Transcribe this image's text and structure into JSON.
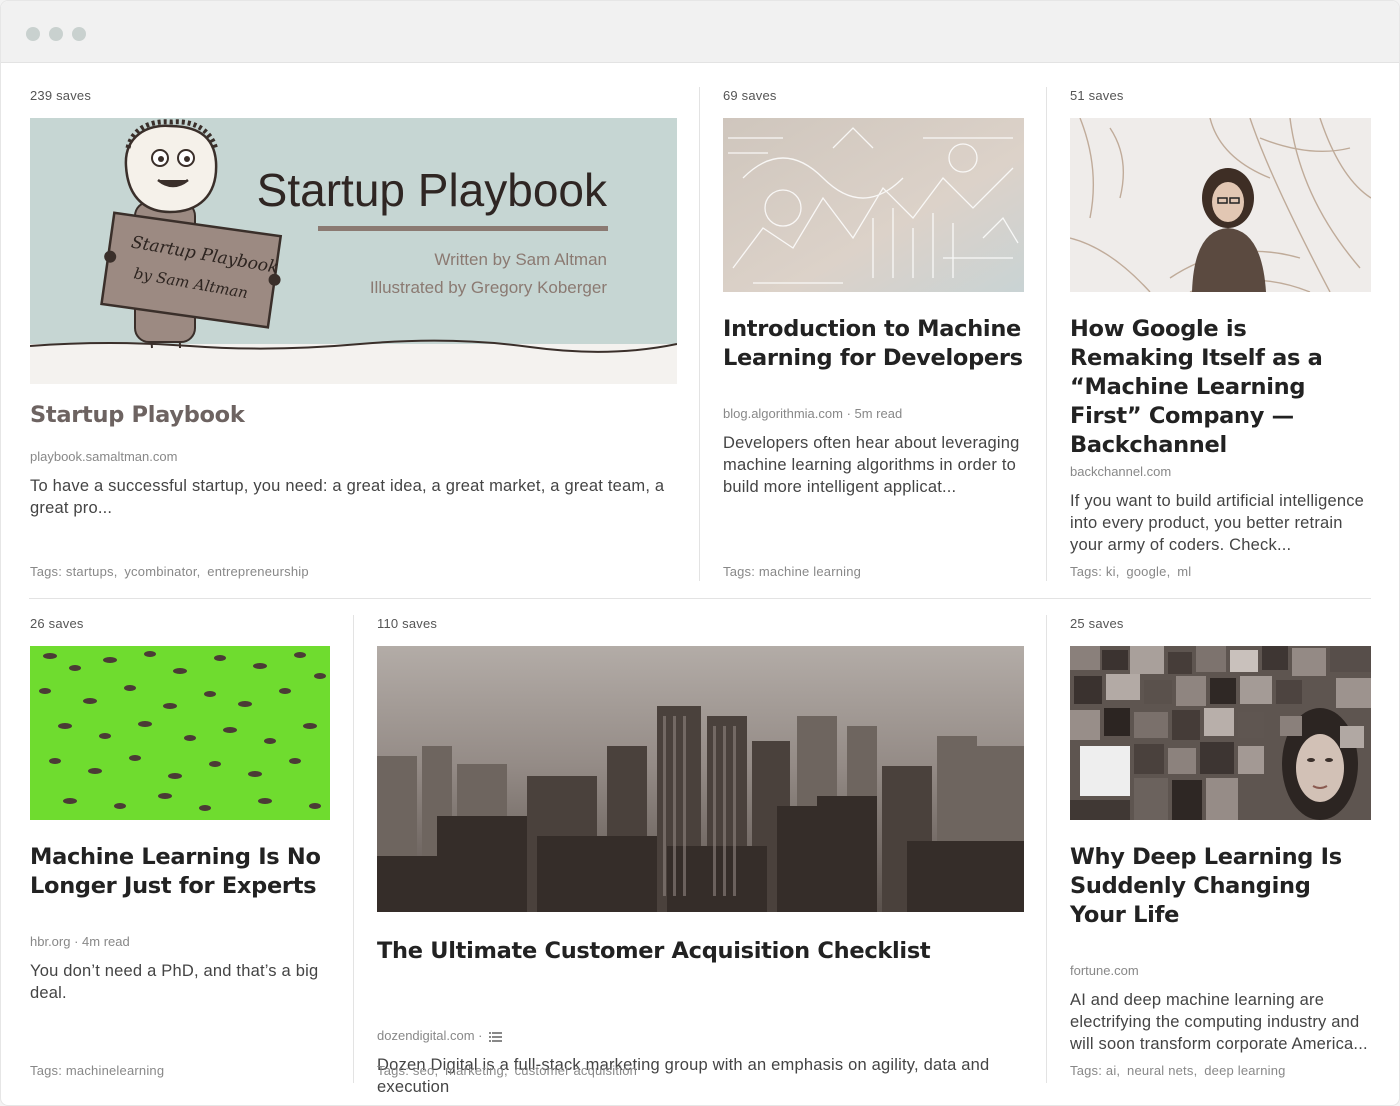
{
  "window": {
    "controls": [
      "close",
      "minimize",
      "maximize"
    ]
  },
  "cards": [
    {
      "saves": "239 saves",
      "image": {
        "title": "Startup Playbook",
        "byline1": "Written by Sam Altman",
        "byline2": "Illustrated by Gregory Koberger",
        "sign_line1": "Startup Playbook",
        "sign_line2": "by Sam Altman"
      },
      "title": "Startup Playbook",
      "domain": "playbook.samaltman.com",
      "excerpt": "To have a successful startup, you need: a great idea, a great market, a great team, a great pro...",
      "tags_label": "Tags:",
      "tags": [
        "startups",
        "ycombinator",
        "entrepreneurship"
      ]
    },
    {
      "saves": "69 saves",
      "title": "Introduction to Machine Learning for Developers",
      "domain": "blog.algorithmia.com",
      "read_time": "5m read",
      "excerpt": "Developers often hear about leveraging machine learning algorithms in order to build more intelligent applicat...",
      "tags_label": "Tags:",
      "tags": [
        "machine learning"
      ]
    },
    {
      "saves": "51 saves",
      "title": "How Google is Remaking Itself as a “Machine Learning First” Company — Backchannel",
      "domain": "backchannel.com",
      "excerpt": "If you want to build artificial intelligence into every product, you better retrain your army of coders. Check...",
      "tags_label": "Tags:",
      "tags": [
        "ki",
        "google",
        "ml"
      ]
    },
    {
      "saves": "26 saves",
      "title": "Machine Learning Is No Longer Just for Experts",
      "domain": "hbr.org",
      "read_time": "4m read",
      "excerpt": "You don’t need a PhD, and that’s a big deal.",
      "tags_label": "Tags:",
      "tags": [
        "machinelearning"
      ]
    },
    {
      "saves": "110 saves",
      "title": "The Ultimate Customer Acquisition Checklist",
      "domain": "dozendigital.com",
      "excerpt": "Dozen Digital is a full-stack marketing group with an emphasis on agility, data and execution",
      "tags_label": "Tags:",
      "tags": [
        "seo",
        "marketing",
        "customer acquisition"
      ]
    },
    {
      "saves": "25 saves",
      "title": "Why Deep Learning Is Suddenly Changing Your Life",
      "domain": "fortune.com",
      "excerpt": "AI and deep machine learning are electrifying the computing industry and will soon transform corporate America...",
      "tags_label": "Tags:",
      "tags": [
        "ai",
        "neural nets",
        "deep learning"
      ]
    }
  ],
  "colors": {
    "title": "#222222",
    "muted_title": "#6d6361",
    "meta": "#888888",
    "divider": "#e3e3e3",
    "green_image": "#6fdc2f"
  }
}
